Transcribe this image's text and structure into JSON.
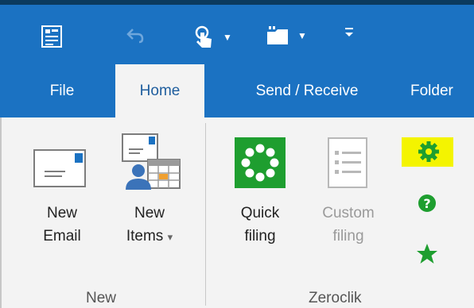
{
  "quick_access": {
    "items": [
      {
        "name": "outlook-tray-icon"
      },
      {
        "name": "undo-icon"
      },
      {
        "name": "touch-mode-icon"
      },
      {
        "name": "folder-icon"
      },
      {
        "name": "customize-icon"
      }
    ]
  },
  "tabs": [
    {
      "label": "File",
      "active": false
    },
    {
      "label": "Home",
      "active": true
    },
    {
      "label": "Send / Receive",
      "active": false
    },
    {
      "label": "Folder",
      "active": false
    }
  ],
  "groups": {
    "new": {
      "label": "New",
      "new_email": {
        "line1": "New",
        "line2": "Email"
      },
      "new_items": {
        "line1": "New",
        "line2": "Items",
        "dropdown": "▾"
      }
    },
    "zeroclik": {
      "label": "Zeroclik",
      "quick_filing": {
        "line1": "Quick",
        "line2": "filing"
      },
      "custom_filing": {
        "line1": "Custom",
        "line2": "filing"
      },
      "small_buttons": [
        {
          "name": "settings-gear-icon",
          "color": "#1e9e2f",
          "highlight": "#f4f400"
        },
        {
          "name": "help-question-icon",
          "color": "#1e9e2f"
        },
        {
          "name": "favorite-star-icon",
          "color": "#1e9e2f"
        }
      ]
    }
  },
  "colors": {
    "title_bar": "#1b72c2",
    "ribbon": "#f3f3f3",
    "accent_green": "#1e9e2f",
    "highlight": "#f4f400"
  }
}
